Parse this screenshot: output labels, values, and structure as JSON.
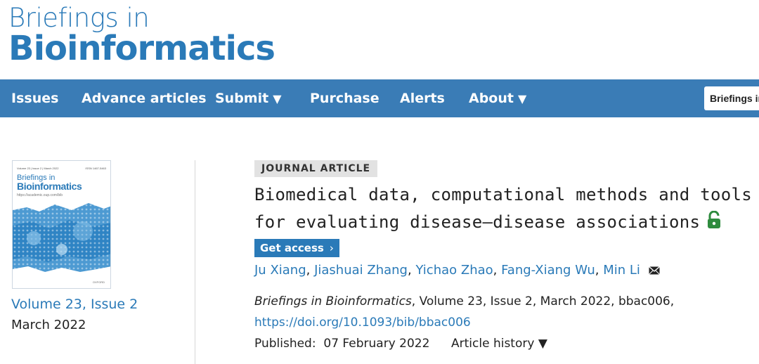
{
  "logo": {
    "line1": "Briefings in",
    "line2": "Bioinformatics"
  },
  "nav": {
    "items": [
      {
        "label": "Issues",
        "caret": ""
      },
      {
        "label": "Advance articles",
        "caret": ""
      },
      {
        "label": "Submit",
        "caret": "▼"
      },
      {
        "label": "Purchase",
        "caret": ""
      },
      {
        "label": "Alerts",
        "caret": ""
      },
      {
        "label": "About",
        "caret": "▼"
      }
    ],
    "search_scope": "Briefings in"
  },
  "sidebar": {
    "cover": {
      "meta": "Volume 23 | Issue 2 | March 2022",
      "meta_right": "ISSN 1467-5463",
      "title_line1": "Briefings in",
      "title_line2": "Bioinformatics",
      "url": "https://academic.oup.com/bib",
      "publisher": "OXFORD"
    },
    "volume_issue": "Volume 23, Issue 2",
    "date": "March 2022"
  },
  "article": {
    "type_badge": "JOURNAL ARTICLE",
    "title_line1": "Biomedical data, computational methods and tools",
    "title_line2": "for evaluating disease–disease associations",
    "get_access": "Get access",
    "authors": [
      "Ju Xiang",
      "Jiashuai Zhang",
      "Yichao Zhao",
      "Fang-Xiang Wu",
      "Min Li"
    ],
    "citation_journal": "Briefings in Bioinformatics",
    "citation_rest": ", Volume 23, Issue 2, March 2022, bbac006,",
    "doi": "https://doi.org/10.1093/bib/bbac006",
    "published_label": "Published:",
    "published_date": "07 February 2022",
    "history_label": "Article history ▼"
  },
  "colors": {
    "brand": "#2a7ab8",
    "navbar": "#3a7cb6",
    "open_access": "#2e8b3e"
  },
  "icons": {
    "open_access": "open-lock-icon",
    "contact": "envelope-icon"
  }
}
